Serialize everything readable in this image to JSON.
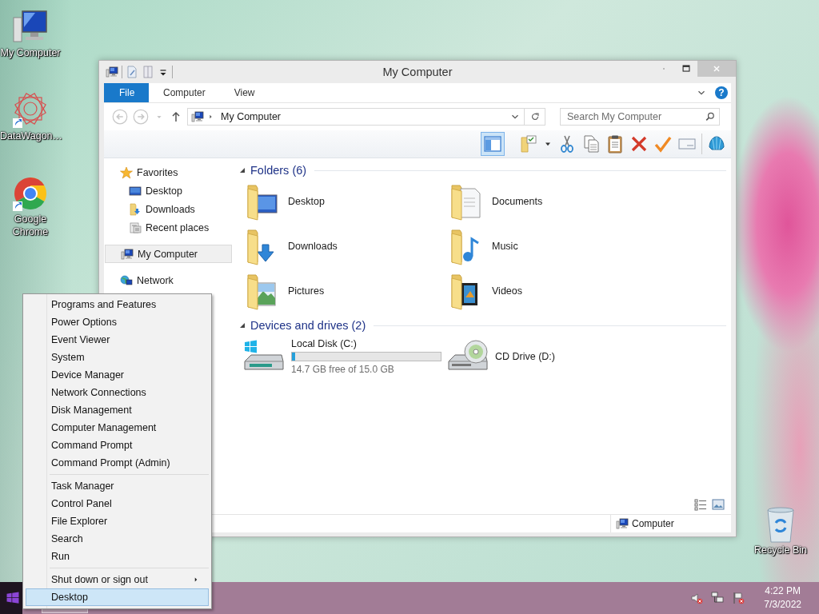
{
  "desktop_icons": [
    {
      "label": "My Computer",
      "kind": "computer"
    },
    {
      "label": "DataWagon…",
      "kind": "app"
    },
    {
      "label": "Google Chrome",
      "kind": "browser"
    },
    {
      "label": "Recycle Bin",
      "kind": "recycle"
    }
  ],
  "window": {
    "title": "My Computer",
    "ribbon_tabs": [
      {
        "label": "File",
        "kind": "file"
      },
      {
        "label": "Computer",
        "kind": "tab"
      },
      {
        "label": "View",
        "kind": "tab"
      }
    ],
    "help_button": "?",
    "address": "My Computer",
    "search": {
      "placeholder": "Search My Computer"
    },
    "nav_pane": [
      {
        "label": "Favorites",
        "kind": "favorites",
        "selected": false,
        "children": [
          {
            "label": "Desktop",
            "kind": "desktop",
            "selected": false
          },
          {
            "label": "Downloads",
            "kind": "downloads",
            "selected": false
          },
          {
            "label": "Recent places",
            "kind": "recent",
            "selected": false
          }
        ]
      },
      {
        "label": "My Computer",
        "kind": "computer",
        "selected": true
      },
      {
        "label": "Network",
        "kind": "network",
        "selected": false
      }
    ],
    "sections": [
      {
        "title": "Folders (6)",
        "expanded": true,
        "items": [
          {
            "name": "Desktop",
            "kind": "desktop"
          },
          {
            "name": "Documents",
            "kind": "documents"
          },
          {
            "name": "Downloads",
            "kind": "downloads"
          },
          {
            "name": "Music",
            "kind": "music"
          },
          {
            "name": "Pictures",
            "kind": "pictures"
          },
          {
            "name": "Videos",
            "kind": "videos"
          }
        ]
      },
      {
        "title": "Devices and drives (2)",
        "expanded": true,
        "items": [
          {
            "name": "Local Disk (C:)",
            "kind": "disk",
            "level": 0.02,
            "free": "14.7 GB free of 15.0 GB"
          },
          {
            "name": "CD Drive (D:)",
            "kind": "cd"
          }
        ]
      }
    ],
    "status_bar": {
      "text": "Computer"
    }
  },
  "context_menu": {
    "groups": [
      [
        {
          "label": "Programs and Features",
          "selected": false,
          "submenu": false
        },
        {
          "label": "Power Options",
          "selected": false,
          "submenu": false
        },
        {
          "label": "Event Viewer",
          "selected": false,
          "submenu": false
        },
        {
          "label": "System",
          "selected": false,
          "submenu": false
        },
        {
          "label": "Device Manager",
          "selected": false,
          "submenu": false
        },
        {
          "label": "Network Connections",
          "selected": false,
          "submenu": false
        },
        {
          "label": "Disk Management",
          "selected": false,
          "submenu": false
        },
        {
          "label": "Computer Management",
          "selected": false,
          "submenu": false
        },
        {
          "label": "Command Prompt",
          "selected": false,
          "submenu": false
        },
        {
          "label": "Command Prompt (Admin)",
          "selected": false,
          "submenu": false
        }
      ],
      [
        {
          "label": "Task Manager",
          "selected": false,
          "submenu": false
        },
        {
          "label": "Control Panel",
          "selected": false,
          "submenu": false
        },
        {
          "label": "File Explorer",
          "selected": false,
          "submenu": false
        },
        {
          "label": "Search",
          "selected": false,
          "submenu": false
        },
        {
          "label": "Run",
          "selected": false,
          "submenu": false
        }
      ],
      [
        {
          "label": "Shut down or sign out",
          "selected": false,
          "submenu": true
        },
        {
          "label": "Desktop",
          "selected": true,
          "submenu": false
        }
      ]
    ]
  },
  "taskbar": {
    "time": "4:22 PM",
    "date": "7/3/2022"
  }
}
